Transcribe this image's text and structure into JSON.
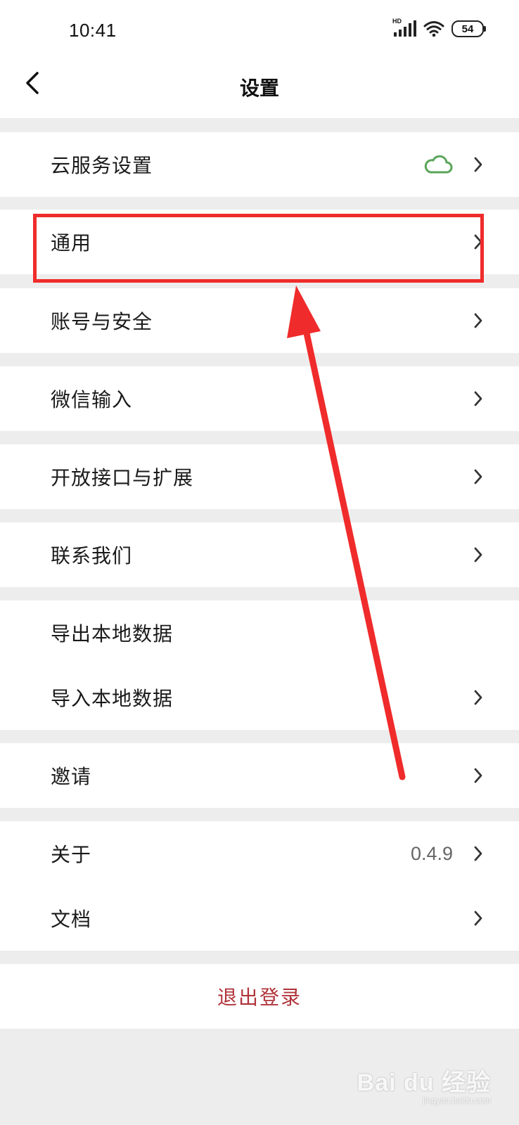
{
  "status_bar": {
    "time": "10:41",
    "network_label": "HD",
    "battery": "54"
  },
  "header": {
    "title": "设置"
  },
  "menu": {
    "cloud_service": "云服务设置",
    "general": "通用",
    "account_security": "账号与安全",
    "wechat_input": "微信输入",
    "open_api": "开放接口与扩展",
    "contact_us": "联系我们",
    "export_data": "导出本地数据",
    "import_data": "导入本地数据",
    "invite": "邀请",
    "about": "关于",
    "about_version": "0.4.9",
    "docs": "文档",
    "logout": "退出登录"
  },
  "annotation": {
    "highlight_color": "#f02b2b"
  },
  "watermark": {
    "brand": "Bai du 经验",
    "url": "jingyan.baidu.com"
  },
  "colors": {
    "cloud_icon": "#5aa55a",
    "logout_text": "#b0333a",
    "background": "#ededed"
  }
}
